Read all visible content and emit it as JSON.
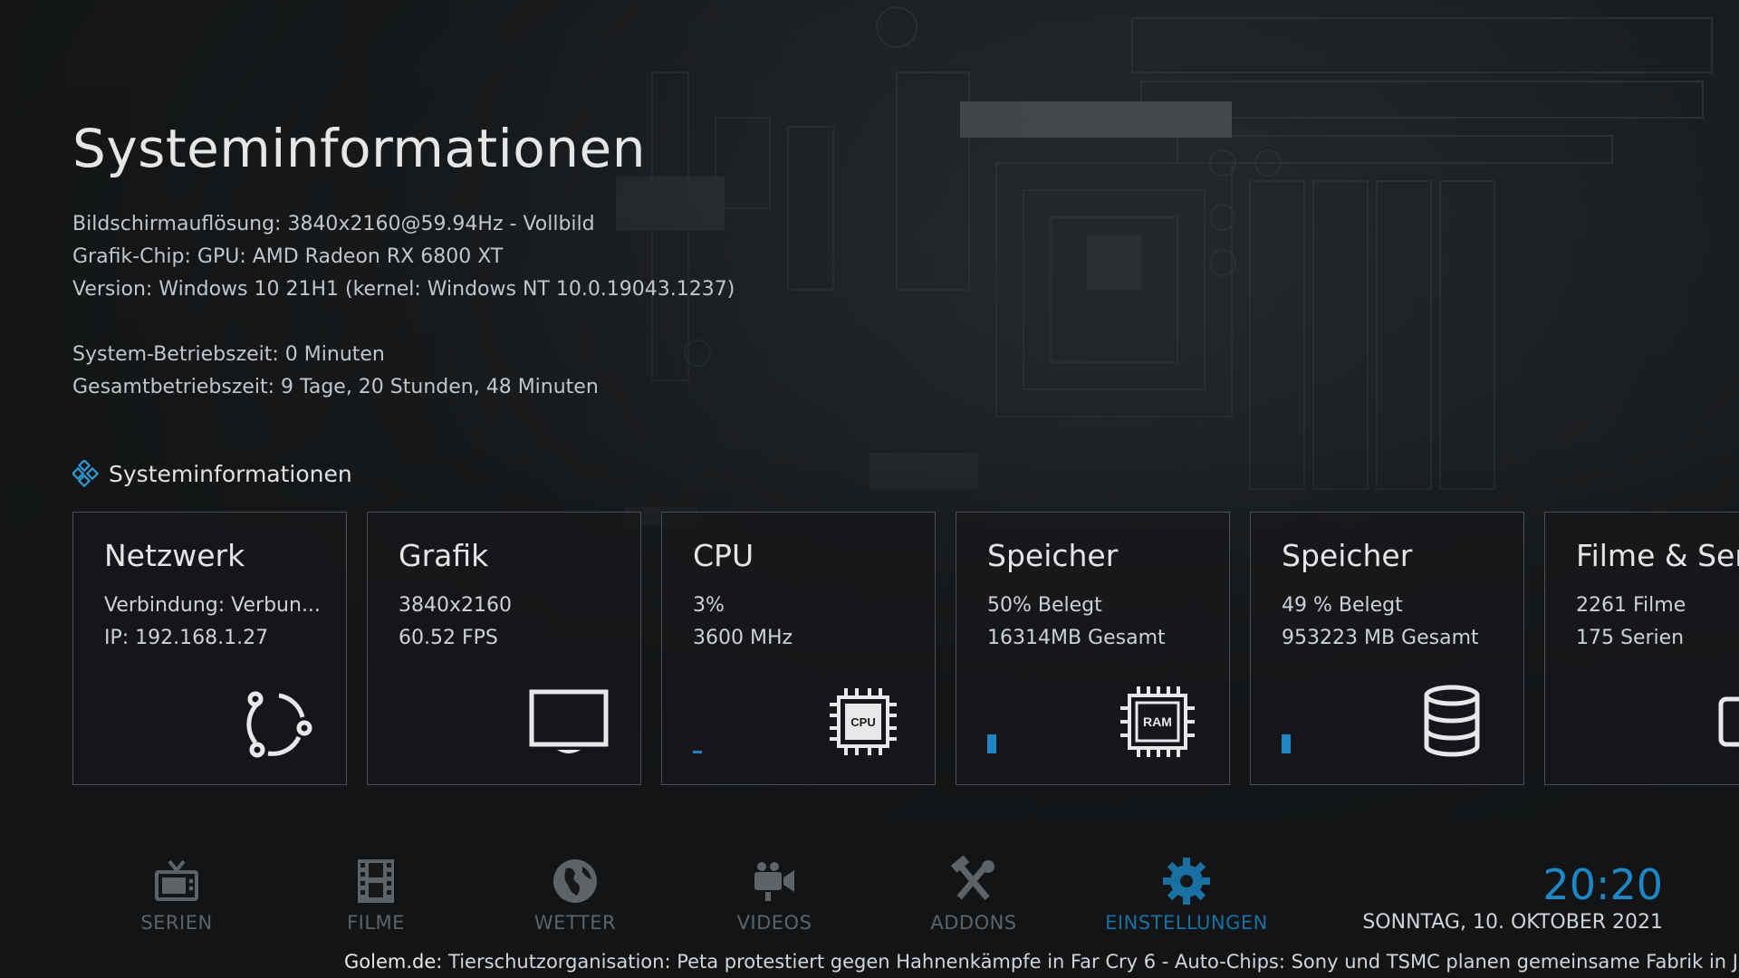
{
  "header": {
    "title": "Systeminformationen"
  },
  "system_info": {
    "resolution": "Bildschirmauflösung: 3840x2160@59.94Hz - Vollbild",
    "graphics_chip": "Grafik-Chip: GPU: AMD Radeon RX 6800 XT",
    "version": "Version: Windows 10 21H1 (kernel: Windows NT 10.0.19043.1237)",
    "uptime": "System-Betriebszeit: 0 Minuten",
    "total_uptime": "Gesamtbetriebszeit: 9 Tage, 20 Stunden, 48 Minuten"
  },
  "section": {
    "label": "Systeminformationen",
    "icon": "kodi-logo-icon"
  },
  "cards": [
    {
      "title": "Netzwerk",
      "line1": "Verbindung: Verbun...",
      "line2": "IP: 192.168.1.27",
      "icon": "network-icon"
    },
    {
      "title": "Grafik",
      "line1": "3840x2160",
      "line2": "60.52 FPS",
      "icon": "monitor-icon"
    },
    {
      "title": "CPU",
      "line1": "3%",
      "line2": "3600 MHz",
      "icon": "cpu-chip-icon",
      "icon_label": "CPU",
      "usage_percent": 3
    },
    {
      "title": "Speicher",
      "line1": "50% Belegt",
      "line2": "16314MB Gesamt",
      "icon": "ram-chip-icon",
      "icon_label": "RAM",
      "usage_percent": 50
    },
    {
      "title": "Speicher",
      "line1": "49 % Belegt",
      "line2": "953223 MB Gesamt",
      "icon": "storage-database-icon",
      "usage_percent": 49
    },
    {
      "title": "Filme & Serien",
      "line1": "2261 Filme",
      "line2": "175 Serien",
      "icon": "library-icon"
    }
  ],
  "nav": [
    {
      "label": "SERIEN",
      "icon": "tv-icon"
    },
    {
      "label": "FILME",
      "icon": "film-strip-icon"
    },
    {
      "label": "WETTER",
      "icon": "globe-icon"
    },
    {
      "label": "VIDEOS",
      "icon": "video-camera-icon"
    },
    {
      "label": "ADDONS",
      "icon": "tools-icon"
    },
    {
      "label": "EINSTELLUNGEN",
      "icon": "gear-icon",
      "active": true
    }
  ],
  "clock": {
    "time": "20:20",
    "date": "SONNTAG, 10. OKTOBER 2021"
  },
  "ticker": {
    "source": "Golem.de:",
    "text": " Tierschutzorganisation: Peta protestiert gegen Hahnenkämpfe in Far Cry 6 - Auto-Chips: Sony und TSMC planen gemeinsame Fabrik in Japan - Squ"
  },
  "colors": {
    "accent": "#1e86c2",
    "nav_inactive": "#5e6367",
    "card_border": "#4b4f53"
  }
}
